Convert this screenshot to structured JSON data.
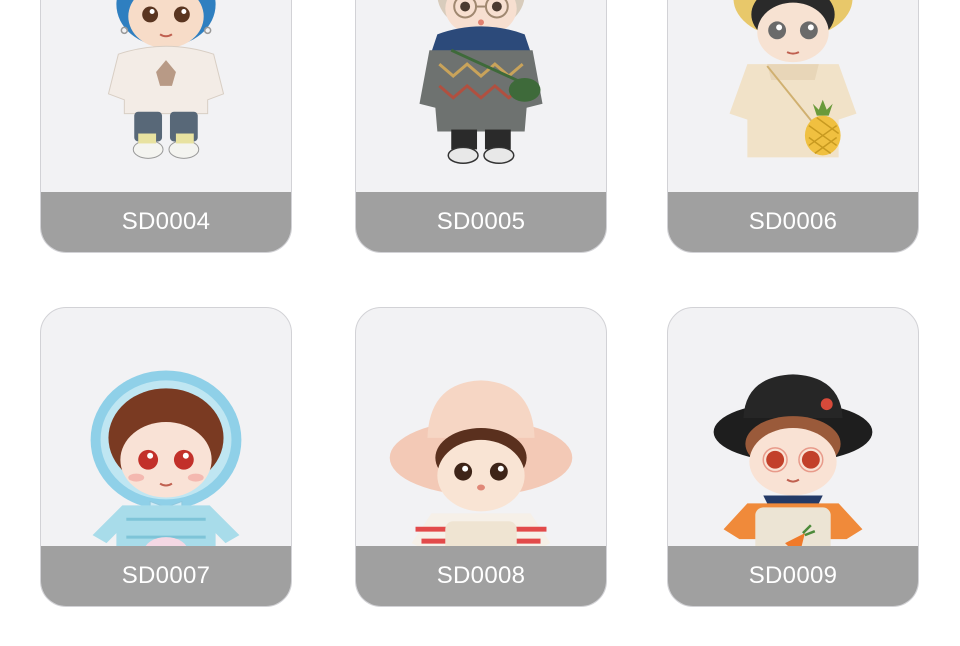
{
  "products": [
    {
      "code": "SD0004",
      "image": "doll-blue-hair-white-hoodie"
    },
    {
      "code": "SD0005",
      "image": "doll-glasses-gray-sweater"
    },
    {
      "code": "SD0006",
      "image": "doll-pineapple-bag-cream-sweater"
    },
    {
      "code": "SD0007",
      "image": "doll-blue-lace-bonnet"
    },
    {
      "code": "SD0008",
      "image": "doll-pink-bucket-hat-overalls"
    },
    {
      "code": "SD0009",
      "image": "doll-black-hat-carrot-overalls"
    }
  ],
  "colors": {
    "card_background": "#f2f2f4",
    "card_border": "#d2d2d6",
    "label_background": "#a0a0a0",
    "label_text": "#ffffff"
  }
}
